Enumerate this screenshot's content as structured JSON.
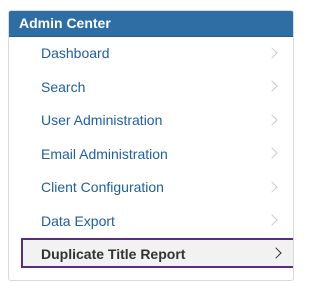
{
  "admin_center": {
    "title": "Admin Center",
    "items": [
      {
        "label": "Dashboard",
        "icon": "chevron-right-icon"
      },
      {
        "label": "Search",
        "icon": "chevron-right-icon"
      },
      {
        "label": "User Administration",
        "icon": "chevron-right-icon"
      },
      {
        "label": "Email Administration",
        "icon": "chevron-right-icon"
      },
      {
        "label": "Client Configuration",
        "icon": "chevron-right-icon"
      },
      {
        "label": "Data Export",
        "icon": "chevron-right-icon"
      },
      {
        "label": "Duplicate Title Report",
        "icon": "chevron-right-icon",
        "selected": true
      }
    ]
  },
  "colors": {
    "header_bg": "#2e6ea5",
    "link_text": "#1f5f9f",
    "active_border": "#5a2d82",
    "active_text": "#333333"
  }
}
